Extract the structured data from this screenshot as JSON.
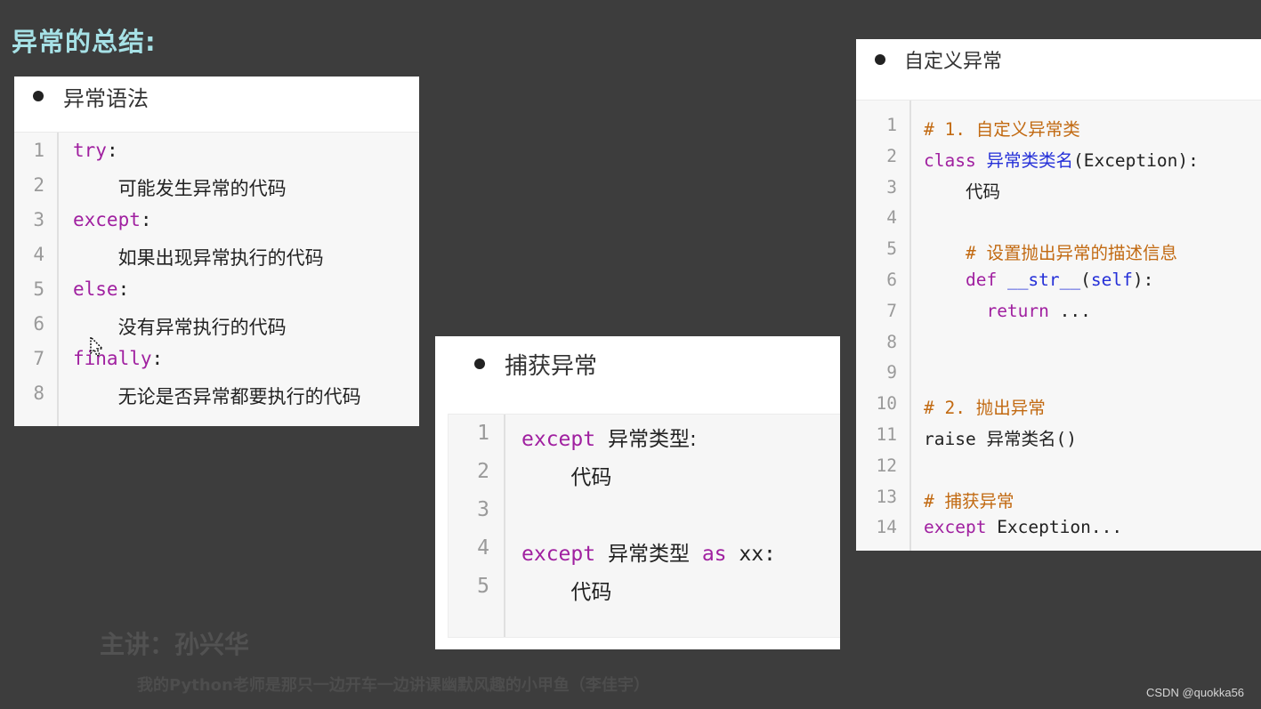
{
  "page": {
    "title": "异常的总结:",
    "lecturer": "主讲：孙兴华",
    "tagline": "我的Python老师是那只一边开车一边讲课幽默风趣的小甲鱼（李佳宇）",
    "watermark": "CSDN @quokka56"
  },
  "colors": {
    "background": "#3d3d3d",
    "title": "#a6e1e6",
    "keyword": "#a020a0",
    "comment": "#c26a12",
    "identifier": "#2530d8"
  },
  "cards": {
    "syntax": {
      "title": "异常语法",
      "lines": [
        {
          "n": "1",
          "indent": "",
          "parts": [
            {
              "t": "try",
              "c": "kw"
            },
            {
              "t": ":",
              "c": ""
            }
          ]
        },
        {
          "n": "2",
          "indent": "    ",
          "parts": [
            {
              "t": "可能发生异常的代码",
              "c": "cn"
            }
          ]
        },
        {
          "n": "3",
          "indent": "",
          "parts": [
            {
              "t": "except",
              "c": "kw"
            },
            {
              "t": ":",
              "c": ""
            }
          ]
        },
        {
          "n": "4",
          "indent": "    ",
          "parts": [
            {
              "t": "如果出现异常执行的代码",
              "c": "cn"
            }
          ]
        },
        {
          "n": "5",
          "indent": "",
          "parts": [
            {
              "t": "else",
              "c": "kw"
            },
            {
              "t": ":",
              "c": ""
            }
          ]
        },
        {
          "n": "6",
          "indent": "    ",
          "parts": [
            {
              "t": "没有异常执行的代码",
              "c": "cn"
            }
          ]
        },
        {
          "n": "7",
          "indent": "",
          "parts": [
            {
              "t": "finally",
              "c": "kw"
            },
            {
              "t": ":",
              "c": ""
            }
          ]
        },
        {
          "n": "8",
          "indent": "    ",
          "parts": [
            {
              "t": "无论是否异常都要执行的代码",
              "c": "cn"
            }
          ]
        }
      ]
    },
    "catch": {
      "title": "捕获异常",
      "lines": [
        {
          "n": "1",
          "indent": "",
          "parts": [
            {
              "t": "except",
              "c": "kw"
            },
            {
              "t": " ",
              "c": ""
            },
            {
              "t": "异常类型:",
              "c": "cn"
            }
          ]
        },
        {
          "n": "2",
          "indent": "    ",
          "parts": [
            {
              "t": "代码",
              "c": "cn"
            }
          ]
        },
        {
          "n": "3",
          "indent": "",
          "parts": []
        },
        {
          "n": "4",
          "indent": "",
          "parts": [
            {
              "t": "except",
              "c": "kw"
            },
            {
              "t": " ",
              "c": ""
            },
            {
              "t": "异常类型",
              "c": "cn"
            },
            {
              "t": " ",
              "c": ""
            },
            {
              "t": "as",
              "c": "kw"
            },
            {
              "t": " xx:",
              "c": ""
            }
          ]
        },
        {
          "n": "5",
          "indent": "    ",
          "parts": [
            {
              "t": "代码",
              "c": "cn"
            }
          ]
        }
      ]
    },
    "custom": {
      "title": "自定义异常",
      "lines": [
        {
          "n": "1",
          "indent": "",
          "parts": [
            {
              "t": "# 1. ",
              "c": "cm"
            },
            {
              "t": "自定义异常类",
              "c": "cm cn"
            }
          ]
        },
        {
          "n": "2",
          "indent": "",
          "parts": [
            {
              "t": "class",
              "c": "kw"
            },
            {
              "t": " ",
              "c": ""
            },
            {
              "t": "异常类类名",
              "c": "fn cn"
            },
            {
              "t": "(Exception):",
              "c": ""
            }
          ]
        },
        {
          "n": "3",
          "indent": "    ",
          "parts": [
            {
              "t": "代码",
              "c": "cn"
            }
          ]
        },
        {
          "n": "4",
          "indent": "",
          "parts": []
        },
        {
          "n": "5",
          "indent": "    ",
          "parts": [
            {
              "t": "# ",
              "c": "cm"
            },
            {
              "t": "设置抛出异常的描述信息",
              "c": "cm cn"
            }
          ]
        },
        {
          "n": "6",
          "indent": "    ",
          "parts": [
            {
              "t": "def",
              "c": "kw"
            },
            {
              "t": " ",
              "c": ""
            },
            {
              "t": "__str__",
              "c": "fn"
            },
            {
              "t": "(",
              "c": ""
            },
            {
              "t": "self",
              "c": "self"
            },
            {
              "t": "):",
              "c": ""
            }
          ]
        },
        {
          "n": "7",
          "indent": "      ",
          "parts": [
            {
              "t": "return",
              "c": "kw"
            },
            {
              "t": " ...",
              "c": ""
            }
          ]
        },
        {
          "n": "8",
          "indent": "",
          "parts": []
        },
        {
          "n": "9",
          "indent": "",
          "parts": []
        },
        {
          "n": "10",
          "indent": "",
          "parts": [
            {
              "t": "# 2. ",
              "c": "cm"
            },
            {
              "t": "抛出异常",
              "c": "cm cn"
            }
          ]
        },
        {
          "n": "11",
          "indent": "",
          "parts": [
            {
              "t": "raise ",
              "c": ""
            },
            {
              "t": "异常类名",
              "c": "cn"
            },
            {
              "t": "()",
              "c": ""
            }
          ]
        },
        {
          "n": "12",
          "indent": "",
          "parts": []
        },
        {
          "n": "13",
          "indent": "",
          "parts": [
            {
              "t": "# ",
              "c": "cm"
            },
            {
              "t": "捕获异常",
              "c": "cm cn"
            }
          ]
        },
        {
          "n": "14",
          "indent": "",
          "parts": [
            {
              "t": "except",
              "c": "kw"
            },
            {
              "t": " Exception...",
              "c": ""
            }
          ]
        }
      ]
    }
  }
}
